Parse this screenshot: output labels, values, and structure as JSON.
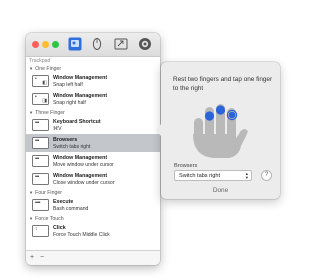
{
  "sidebar": {
    "section_title": "Trackpad",
    "groups": [
      {
        "label": "One Finger",
        "items": [
          {
            "title": "Window Management",
            "subtitle": "Snap left half",
            "icon": "one-finger-gesture-icon"
          },
          {
            "title": "Window Management",
            "subtitle": "Snap right half",
            "icon": "one-finger-gesture-icon"
          }
        ]
      },
      {
        "label": "Three Finger",
        "items": [
          {
            "title": "Keyboard Shortcut",
            "subtitle": "⌘V",
            "icon": "three-finger-gesture-icon"
          },
          {
            "title": "Browsers",
            "subtitle": "Switch tabs right",
            "icon": "three-finger-gesture-icon"
          },
          {
            "title": "Window Management",
            "subtitle": "Move window under cursor",
            "icon": "three-finger-gesture-icon"
          },
          {
            "title": "Window Management",
            "subtitle": "Close window under cursor",
            "icon": "three-finger-gesture-icon"
          }
        ]
      },
      {
        "label": "Four Finger",
        "items": [
          {
            "title": "Execute",
            "subtitle": "Bash command",
            "icon": "four-finger-gesture-icon"
          }
        ]
      },
      {
        "label": "Force Touch",
        "items": [
          {
            "title": "Click",
            "subtitle": "Force Touch Middle Click",
            "icon": "force-touch-icon"
          }
        ]
      }
    ],
    "selected_item": "Browsers",
    "bottom_add": "+",
    "bottom_remove": "−"
  },
  "toolbar": {
    "icons": [
      "trackpad-tab-icon",
      "magic-mouse-tab-icon",
      "keyboard-tab-icon",
      "settings-tab-icon"
    ]
  },
  "popover": {
    "instruction": "Rest two fingers and tap one finger to the right",
    "command_label": "Browsers",
    "command_value": "Switch tabs right",
    "help": "?",
    "done": "Done"
  },
  "colors": {
    "selected_row": "#c3c7cc",
    "finger_dot": "#2b63d8",
    "traffic_close": "#fc5f57",
    "traffic_minimize": "#fdbc2e",
    "traffic_zoom": "#28c840"
  }
}
